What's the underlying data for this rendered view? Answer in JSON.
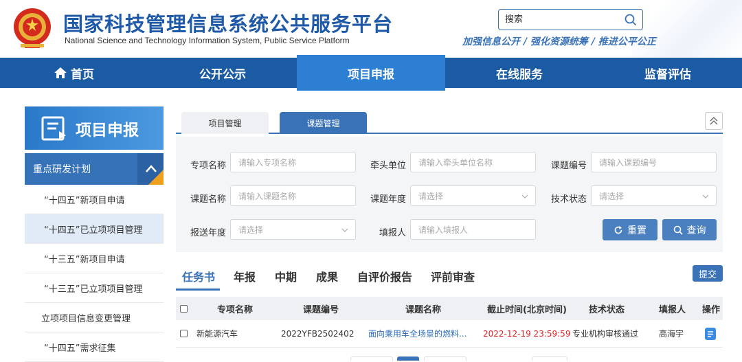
{
  "header": {
    "title": "国家科技管理信息系统公共服务平台",
    "subtitle": "National Science and Technology Information System, Public Service Platform",
    "search_placeholder": "搜索",
    "slogan": "加强信息公开 / 强化资源统筹 / 推进公平公正"
  },
  "nav": {
    "items": [
      "首页",
      "公开公示",
      "项目申报",
      "在线服务",
      "监督评估"
    ],
    "active": "项目申报"
  },
  "sidebar": {
    "banner": "项目申报",
    "group": "重点研发计划",
    "items": [
      "“十四五”新项目申请",
      "“十四五”已立项项目管理",
      "“十三五”新项目申请",
      "“十三五”已立项项目管理",
      "立项项目信息变更管理",
      "“十四五”需求征集"
    ],
    "active_item": "“十四五”已立项项目管理"
  },
  "tabs": [
    "项目管理",
    "课题管理"
  ],
  "active_tab": "课题管理",
  "filters": {
    "special_name": {
      "label": "专项名称",
      "placeholder": "请输入专项名称"
    },
    "lead_unit": {
      "label": "牵头单位",
      "placeholder": "请输入牵头单位名称"
    },
    "topic_no": {
      "label": "课题编号",
      "placeholder": "请输入课题编号"
    },
    "topic_name": {
      "label": "课题名称",
      "placeholder": "请输入课题名称"
    },
    "topic_year": {
      "label": "课题年度",
      "placeholder": "请选择"
    },
    "tech_status": {
      "label": "技术状态",
      "placeholder": "请选择"
    },
    "submit_year": {
      "label": "报送年度",
      "placeholder": "请选择"
    },
    "filler": {
      "label": "填报人",
      "placeholder": "请输入填报人"
    },
    "reset_label": "重置",
    "query_label": "查询"
  },
  "sub_tabs": [
    "任务书",
    "年报",
    "中期",
    "成果",
    "自评价报告",
    "评前审查"
  ],
  "active_sub_tab": "任务书",
  "submit_label": "提交",
  "table": {
    "headers": [
      "专项名称",
      "课题编号",
      "课题名称",
      "截止时间(北京时间)",
      "技术状态",
      "填报人",
      "操作"
    ],
    "rows": [
      {
        "special": "新能源汽车",
        "no": "2022YFB2502402",
        "name": "面向乘用车全场景的燃料...",
        "deadline": "2022-12-19 23:59:59",
        "status": "专业机构审核通过",
        "filler": "高海宇",
        "action_icon": "document-icon"
      }
    ]
  },
  "colors": {
    "primary": "#1a5ba3",
    "accent": "#3a72b8",
    "deadline": "#e02020"
  }
}
